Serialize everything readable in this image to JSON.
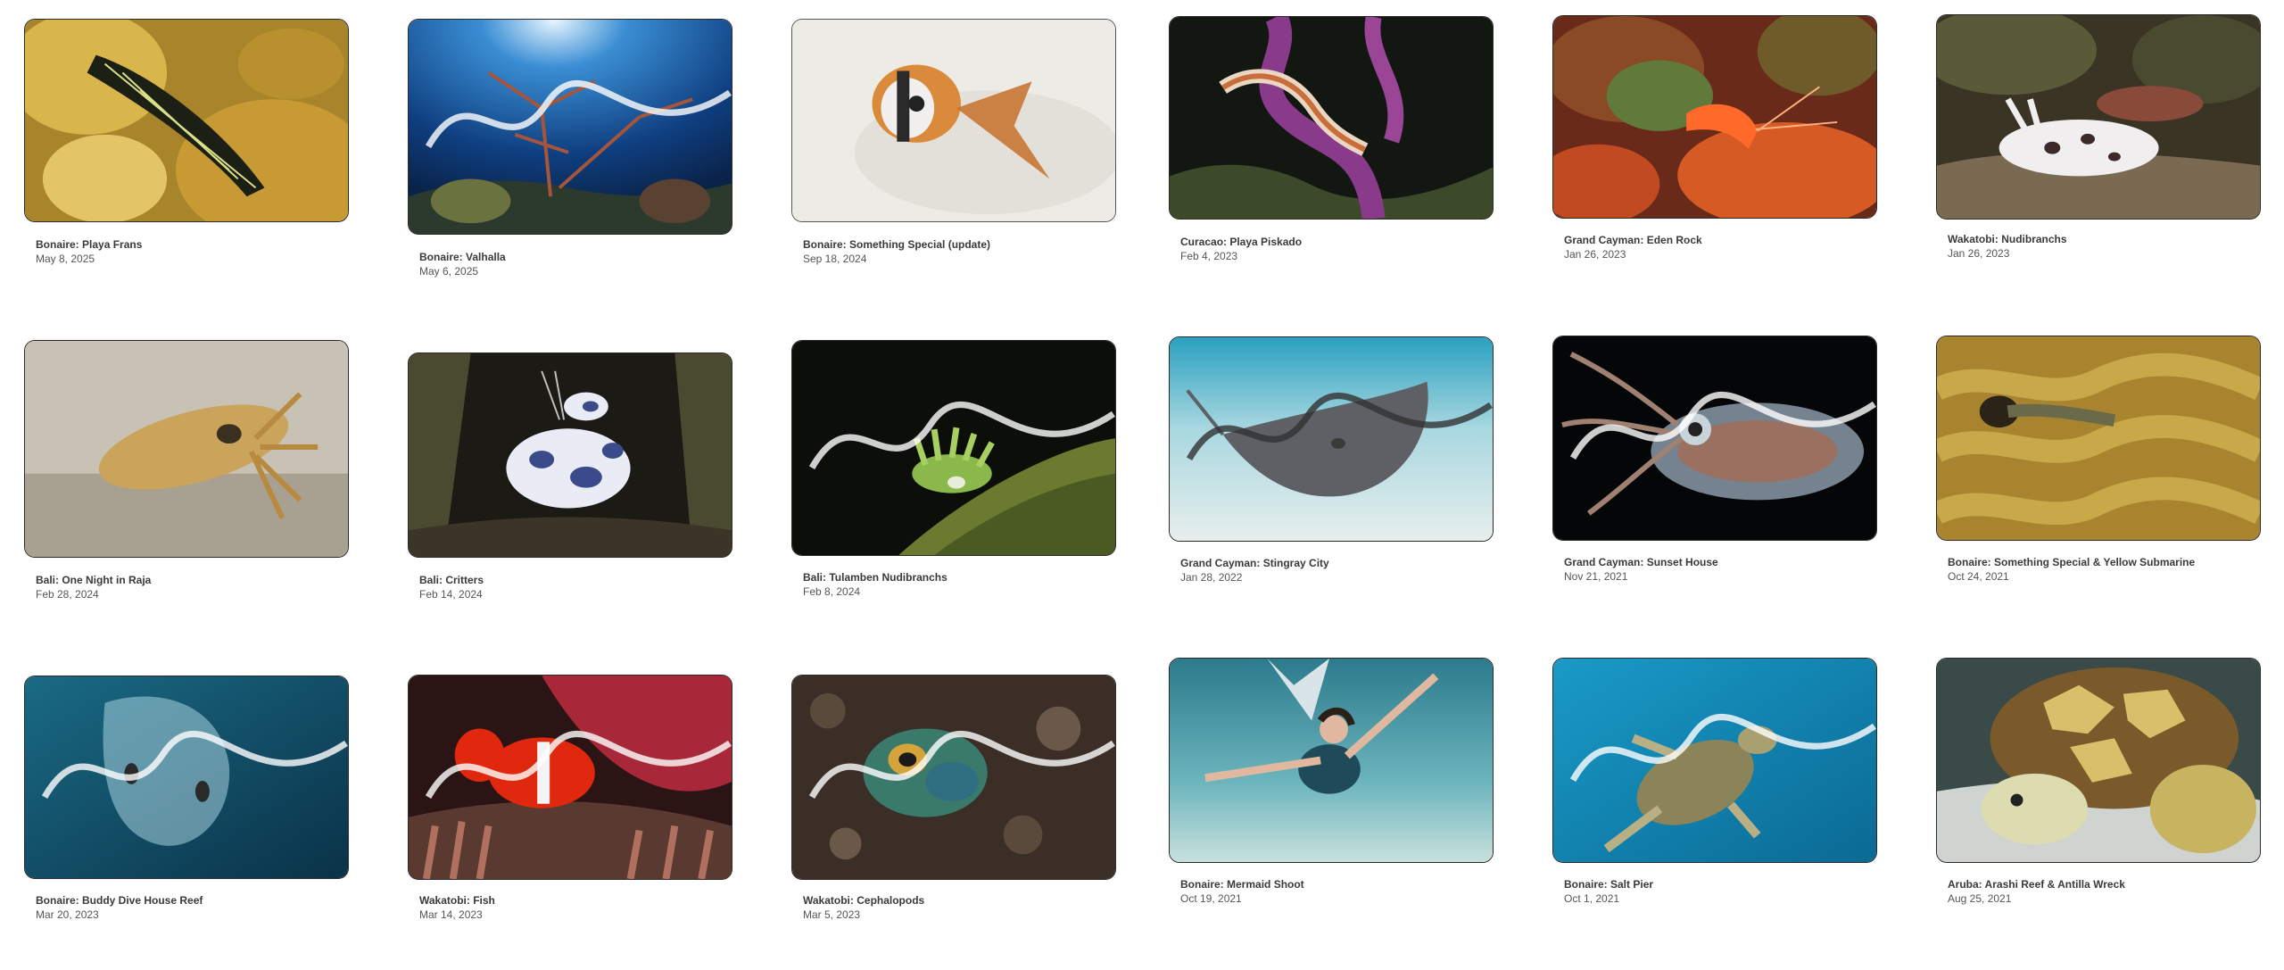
{
  "gallery": {
    "items": [
      {
        "title": "Bonaire: Playa Frans",
        "date": "May 8, 2025",
        "icon": "nudibranch-photo-icon"
      },
      {
        "title": "Bonaire: Valhalla",
        "date": "May 6, 2025",
        "icon": "reef-photo-icon"
      },
      {
        "title": "Bonaire: Something Special (update)",
        "date": "Sep 18, 2024",
        "icon": "fish-photo-icon"
      },
      {
        "title": "Curacao: Playa Piskado",
        "date": "Feb 4, 2023",
        "icon": "fireworm-photo-icon"
      },
      {
        "title": "Grand Cayman: Eden Rock",
        "date": "Jan 26, 2023",
        "icon": "shrimp-photo-icon"
      },
      {
        "title": "Wakatobi: Nudibranchs",
        "date": "Jan 26, 2023",
        "icon": "nudibranch-photo-icon"
      },
      {
        "title": "Bali: One Night in Raja",
        "date": "Feb 28, 2024",
        "icon": "cuttlefish-photo-icon"
      },
      {
        "title": "Bali: Critters",
        "date": "Feb 14, 2024",
        "icon": "harlequin-shrimp-photo-icon"
      },
      {
        "title": "Bali: Tulamben Nudibranchs",
        "date": "Feb 8, 2024",
        "icon": "nudibranch-photo-icon"
      },
      {
        "title": "Grand Cayman: Stingray City",
        "date": "Jan 28, 2022",
        "icon": "stingray-photo-icon"
      },
      {
        "title": "Grand Cayman: Sunset House",
        "date": "Nov 21, 2021",
        "icon": "squid-photo-icon"
      },
      {
        "title": "Bonaire: Something Special & Yellow Submarine",
        "date": "Oct 24, 2021",
        "icon": "blenny-photo-icon"
      },
      {
        "title": "Bonaire: Buddy Dive House Reef",
        "date": "Mar 20, 2023",
        "icon": "jellyfish-photo-icon"
      },
      {
        "title": "Wakatobi: Fish",
        "date": "Mar 14, 2023",
        "icon": "clownfish-photo-icon"
      },
      {
        "title": "Wakatobi: Cephalopods",
        "date": "Mar 5, 2023",
        "icon": "bobtail-squid-photo-icon"
      },
      {
        "title": "Bonaire: Mermaid Shoot",
        "date": "Oct 19, 2021",
        "icon": "mermaid-photo-icon"
      },
      {
        "title": "Bonaire: Salt Pier",
        "date": "Oct 1, 2021",
        "icon": "turtle-photo-icon"
      },
      {
        "title": "Aruba: Arashi Reef & Antilla Wreck",
        "date": "Aug 25, 2021",
        "icon": "turtle-photo-icon"
      }
    ]
  },
  "colors": {
    "title_text": "#3a3a3a",
    "date_text": "#555555",
    "thumb_border": "#2a2a2a"
  }
}
